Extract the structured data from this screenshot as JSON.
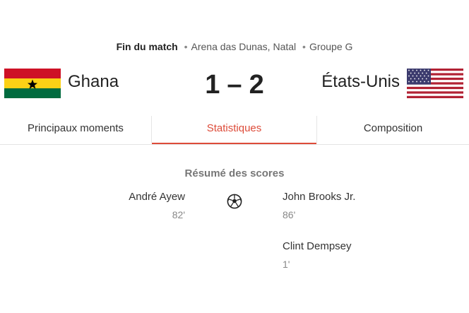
{
  "match": {
    "status": "Fin du match",
    "venue": "Arena das Dunas, Natal",
    "group": "Groupe G",
    "separator": "•"
  },
  "home": {
    "name": "Ghana",
    "score": "1",
    "flag_icon": "ghana-flag-icon"
  },
  "away": {
    "name": "États-Unis",
    "score": "2",
    "flag_icon": "usa-flag-icon"
  },
  "score_dash": "–",
  "tabs": [
    {
      "label": "Principaux moments",
      "active": false
    },
    {
      "label": "Statistiques",
      "active": true
    },
    {
      "label": "Composition",
      "active": false
    }
  ],
  "summary": {
    "title": "Résumé des scores",
    "icon": "soccer-ball-icon",
    "home_goals": [
      {
        "player": "André Ayew",
        "minute": "82'"
      }
    ],
    "away_goals": [
      {
        "player": "John Brooks Jr.",
        "minute": "86'"
      },
      {
        "player": "Clint Dempsey",
        "minute": "1'"
      }
    ]
  },
  "colors": {
    "accent": "#dd4b39",
    "ghana_red": "#ce1126",
    "ghana_gold": "#fcd116",
    "ghana_green": "#006b3f",
    "usa_red": "#b22234",
    "usa_blue": "#3c3b6e"
  }
}
